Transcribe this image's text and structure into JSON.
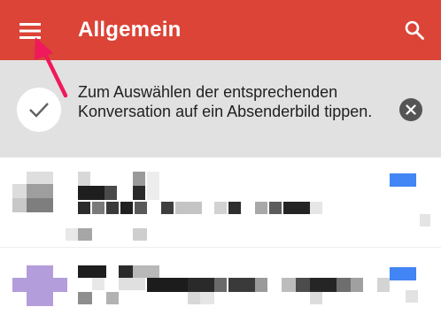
{
  "appbar": {
    "title": "Allgemein",
    "menu_icon": "hamburger-menu-icon",
    "search_icon": "search-icon",
    "color": "#DB4437"
  },
  "banner": {
    "text": "Zum Auswählen der entsprechenden Konversation auf ein Absenderbild tippen.",
    "check_icon": "checkmark-icon",
    "close_icon": "close-icon",
    "background": "#E1E1E1"
  },
  "annotation": {
    "arrow_color": "#F0195C"
  },
  "conversations": [
    {
      "redacted": true,
      "label_color": "#4285F4"
    },
    {
      "redacted": true,
      "label_color": "#4285F4",
      "avatar_color": "#B39DDB"
    }
  ]
}
